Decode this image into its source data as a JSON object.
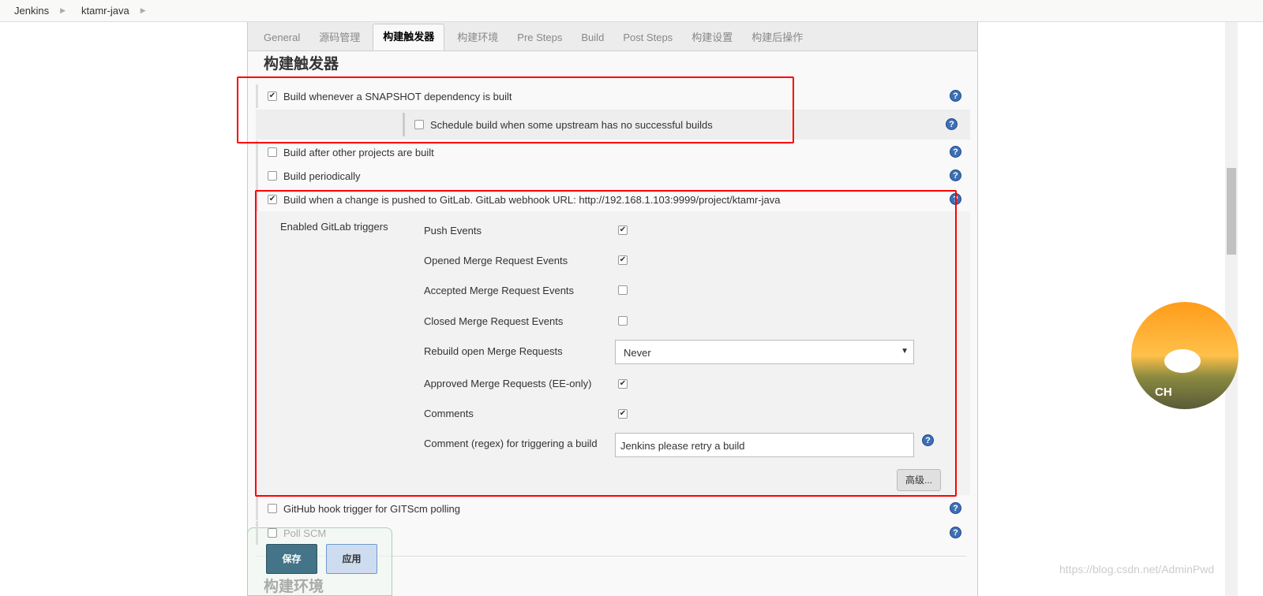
{
  "breadcrumb": [
    "Jenkins",
    "ktamr-java"
  ],
  "tabs": [
    "General",
    "源码管理",
    "构建触发器",
    "构建环境",
    "Pre Steps",
    "Build",
    "Post Steps",
    "构建设置",
    "构建后操作"
  ],
  "active_tab": "构建触发器",
  "section_title": "构建触发器",
  "triggers": [
    {
      "label": "Build whenever a SNAPSHOT dependency is built",
      "checked": true
    },
    {
      "label": "Schedule build when some upstream has no successful builds",
      "checked": false
    },
    {
      "label": "Build after other projects are built",
      "checked": false
    },
    {
      "label": "Build periodically",
      "checked": false
    },
    {
      "label": "Build when a change is pushed to GitLab. GitLab webhook URL: http://192.168.1.103:9999/project/ktamr-java",
      "checked": true
    },
    {
      "label": "GitHub hook trigger for GITScm polling",
      "checked": false
    },
    {
      "label": "Poll SCM",
      "checked": false
    }
  ],
  "gitlab": {
    "group_label": "Enabled GitLab triggers",
    "options": [
      {
        "label": "Push Events",
        "checked": true
      },
      {
        "label": "Opened Merge Request Events",
        "checked": true
      },
      {
        "label": "Accepted Merge Request Events",
        "checked": false
      },
      {
        "label": "Closed Merge Request Events",
        "checked": false
      }
    ],
    "rebuild_label": "Rebuild open Merge Requests",
    "rebuild_value": "Never",
    "options2": [
      {
        "label": "Approved Merge Requests (EE-only)",
        "checked": true
      },
      {
        "label": "Comments",
        "checked": true
      }
    ],
    "comment_label": "Comment (regex) for triggering a build",
    "comment_value": "Jenkins please retry a build",
    "advanced": "高级..."
  },
  "next_section": "构建环境",
  "buttons": {
    "save": "保存",
    "apply": "应用"
  },
  "avatar_text": "CH",
  "watermark": "https://blog.csdn.net/AdminPwd",
  "colors": {
    "highlight": "#ff0000",
    "save": "#437487",
    "help": "#3d6fb6"
  }
}
